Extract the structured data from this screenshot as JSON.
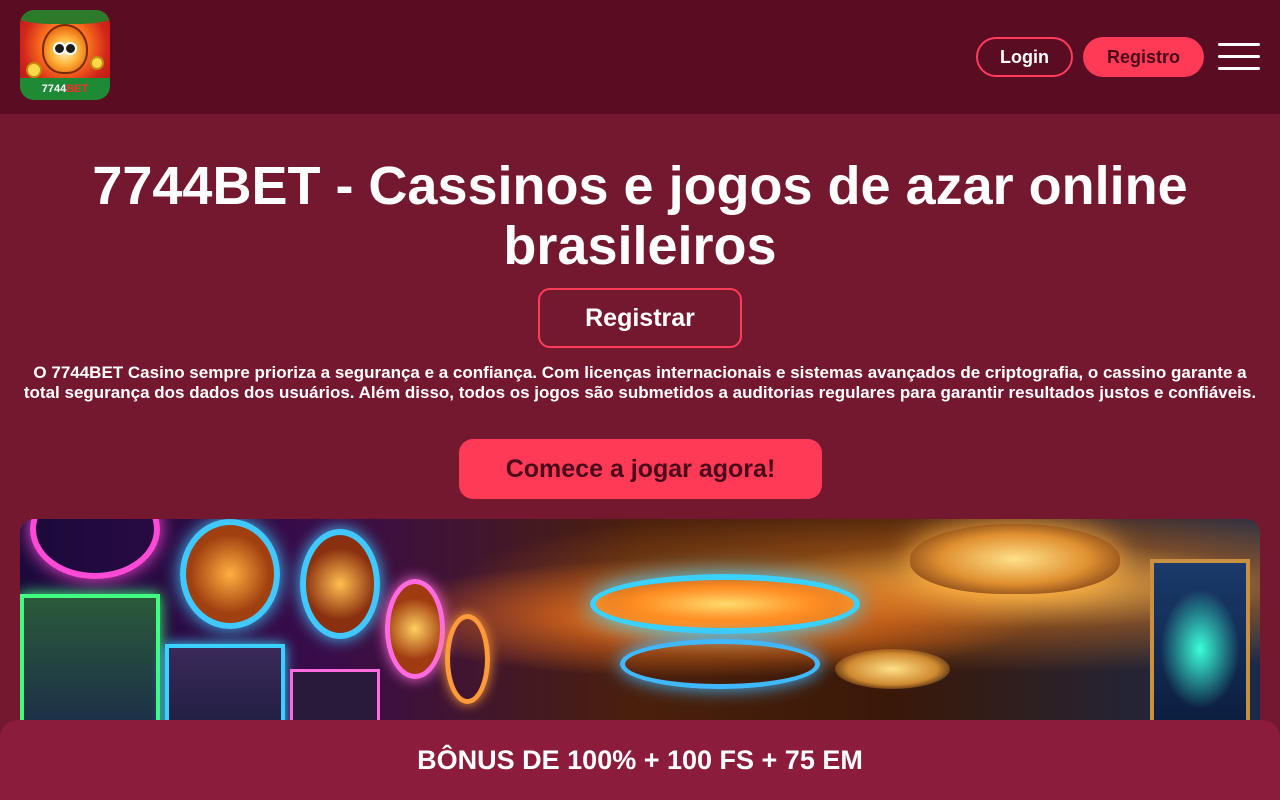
{
  "header": {
    "logo_text_white": "7744",
    "logo_text_red": "BET",
    "login_label": "Login",
    "register_label": "Registro",
    "menu_icon": "hamburger-menu-icon"
  },
  "main": {
    "title": "7744BET - Cassinos e jogos de azar online brasileiros",
    "registrar_label": "Registrar",
    "description": "O 7744BET Casino sempre prioriza a segurança e a confiança. Com licenças internacionais e sistemas avançados de criptografia, o cassino garante a total segurança dos dados dos usuários. Além disso, todos os jogos são submetidos a auditorias regulares para garantir resultados justos e confiáveis.",
    "cta_label": "Comece a jogar agora!"
  },
  "bonus": {
    "text": "BÔNUS DE 100% + 100 FS + 75 EM"
  },
  "colors": {
    "background": "#741830",
    "header": "#5a0c22",
    "accent": "#ff3a57",
    "bonus_bar": "#8c1c3b"
  }
}
